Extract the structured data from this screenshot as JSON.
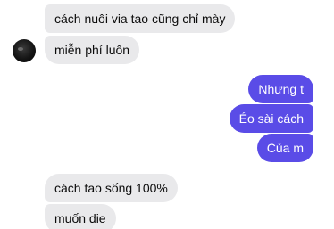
{
  "colors": {
    "incoming_bubble": "#e9e9eb",
    "outgoing_bubble": "#5a4ce7",
    "incoming_text": "#0b0b0b",
    "outgoing_text": "#ffffff"
  },
  "messages": [
    {
      "side": "incoming",
      "text": "cách nuôi via tao cũng chỉ mày"
    },
    {
      "side": "incoming",
      "text": "miễn phí luôn"
    },
    {
      "side": "outgoing",
      "text": "Nhưng t"
    },
    {
      "side": "outgoing",
      "text": "Éo sài cách"
    },
    {
      "side": "outgoing",
      "text": "Của m"
    },
    {
      "side": "incoming",
      "text": "cách tao sống 100%"
    },
    {
      "side": "incoming",
      "text": "muốn die"
    }
  ],
  "avatar": {
    "icon": "contact-avatar"
  }
}
